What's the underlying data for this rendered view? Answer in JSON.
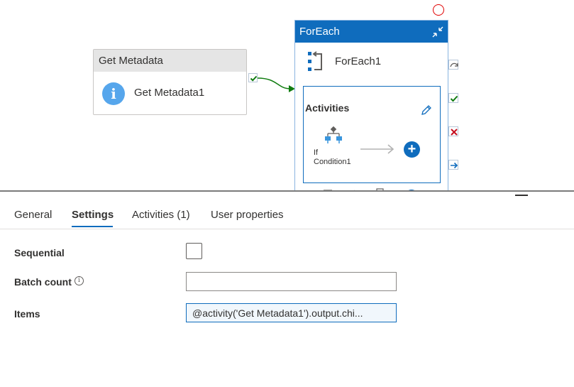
{
  "canvas": {
    "get_metadata": {
      "header": "Get Metadata",
      "name": "Get Metadata1",
      "icon": "info-icon"
    },
    "foreach": {
      "header": "ForEach",
      "name": "ForEach1",
      "activities_title": "Activities",
      "inner_activity": {
        "name_line1": "If",
        "name_line2": "Condition1",
        "icon": "if-condition-icon"
      },
      "add_symbol": "+"
    }
  },
  "tabs": [
    {
      "label": "General",
      "active": false
    },
    {
      "label": "Settings",
      "active": true
    },
    {
      "label": "Activities (1)",
      "active": false
    },
    {
      "label": "User properties",
      "active": false
    }
  ],
  "settings": {
    "sequential_label": "Sequential",
    "sequential_checked": false,
    "batch_count_label": "Batch count",
    "batch_count_value": "",
    "items_label": "Items",
    "items_value": "@activity('Get Metadata1').output.chi..."
  },
  "colors": {
    "accent": "#0f6cbd",
    "success": "#107c10",
    "error": "#c50f1f"
  }
}
